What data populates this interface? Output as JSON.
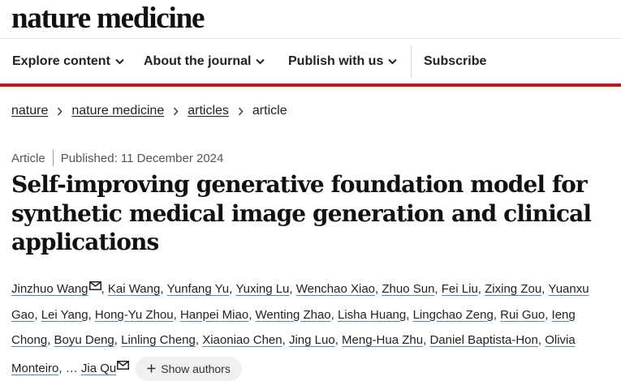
{
  "brand": {
    "logo_text": "nature medicine"
  },
  "nav": {
    "items": [
      {
        "label": "Explore content"
      },
      {
        "label": "About the journal"
      },
      {
        "label": "Publish with us"
      }
    ],
    "subscribe_label": "Subscribe"
  },
  "breadcrumb": {
    "items": [
      {
        "label": "nature"
      },
      {
        "label": "nature medicine"
      },
      {
        "label": "articles"
      }
    ],
    "current": "article"
  },
  "article": {
    "type": "Article",
    "published": "Published: 11 December 2024",
    "title": "Self-improving generative foundation model for synthetic medical image generation and clinical applications"
  },
  "authors": {
    "list": [
      "Jinzhuo Wang",
      "Kai Wang",
      "Yunfang Yu",
      "Yuxing Lu",
      "Wenchao Xiao",
      "Zhuo Sun",
      "Fei Liu",
      "Zixing Zou",
      "Yuanxu Gao",
      "Lei Yang",
      "Hong-Yu Zhou",
      "Hanpei Miao",
      "Wenting Zhao",
      "Lisha Huang",
      "Lingchao Zeng",
      "Rui Guo",
      "Ieng Chong",
      "Boyu Deng",
      "Linling Cheng",
      "Xiaoniao Chen",
      "Jing Luo",
      "Meng-Hua Zhu",
      "Daniel Baptista-Hon",
      "Olivia Monteiro",
      "Jia Qu"
    ],
    "separator": ", ",
    "ellipsis": ", … ",
    "show_button_label": "Show authors",
    "link_underline_color": "#4a8bbd"
  },
  "colors": {
    "accent": "#c5161d",
    "text": "#222222"
  },
  "icons": {
    "nav_dropdown": "chevron-down-icon",
    "breadcrumb_separator": "chevron-right-icon",
    "corresponding_author": "mail-icon",
    "show_authors": "plus-icon"
  }
}
